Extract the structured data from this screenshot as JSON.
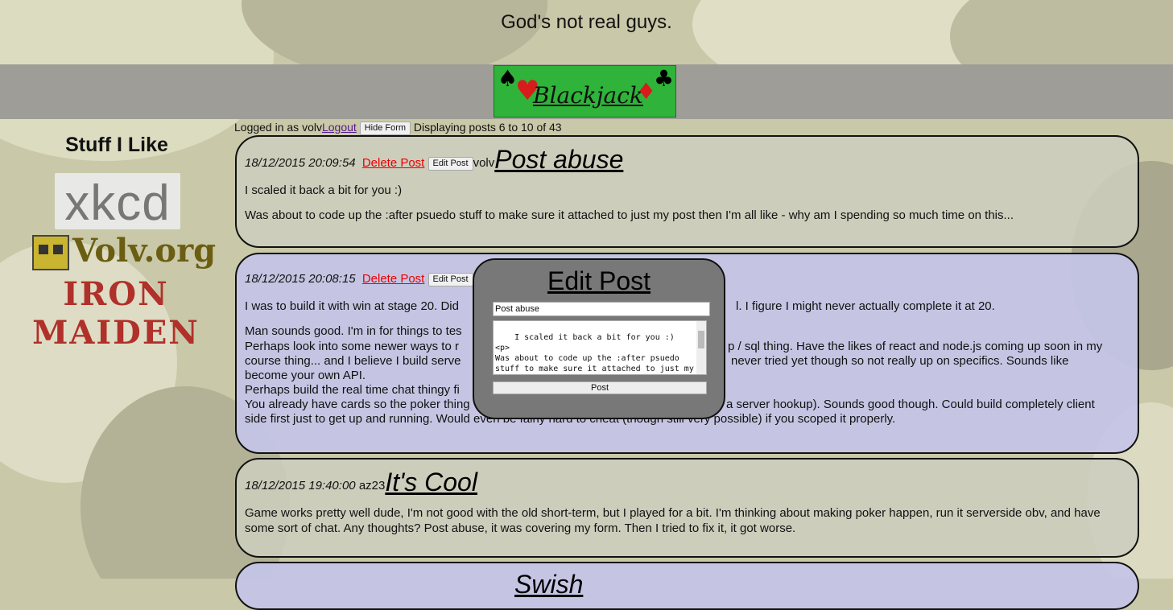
{
  "header": {
    "tagline": "God's not real guys."
  },
  "logo": {
    "title": "Blackjack",
    "suits": [
      "♠",
      "♥",
      "♦",
      "♣"
    ]
  },
  "sidebar": {
    "heading": "Stuff I Like",
    "links": [
      "xkcd",
      "Volv.org",
      "IRON MAIDEN"
    ]
  },
  "status_bar": {
    "logged_in_text": "Logged in as volv",
    "logout_label": "Logout",
    "hide_form_label": "Hide Form",
    "displaying_text": "Displaying posts 6 to 10 of 43"
  },
  "posts": [
    {
      "date": "18/12/2015 20:09:54",
      "delete_label": "Delete Post",
      "edit_label": "Edit Post",
      "author": "volv",
      "title": "Post abuse",
      "paragraphs": [
        "I scaled it back a bit for you :)",
        "Was about to code up the :after psuedo stuff to make sure it attached to just my post then I'm all like - why am I spending so much time on this..."
      ]
    },
    {
      "date": "18/12/2015 20:08:15",
      "delete_label": "Delete Post",
      "edit_label": "Edit Post",
      "lines": [
        "I was to build it with win at stage 20. Did",
        "l. I figure I might never actually complete it at 20.",
        "Man sounds good. I'm in for things to tes",
        "Perhaps look into some newer ways to r",
        "p / sql thing. Have the likes of react and node.js coming up soon in my",
        "course thing... and I believe I build serve",
        "never tried yet though so not really up on specifics. Sounds like",
        "become your own API.",
        "Perhaps build the real time chat thingy fi",
        "You already have cards so the poker thing",
        "a server hookup). Sounds good though. Could build completely client",
        "side first just to get up and running. Would even be fairly hard to cheat (though still very possible) if you scoped it properly."
      ]
    },
    {
      "date": "18/12/2015 19:40:00",
      "author": "az23",
      "title": "It's Cool",
      "paragraphs": [
        "Game works pretty well dude, I'm not good with the old short-term, but I played for a bit. I'm thinking about making poker happen, run it serverside obv, and have some sort of chat. Any thoughts? Post abuse, it was covering my form. Then I tried to fix it, it got worse."
      ]
    },
    {
      "title": "Swish"
    }
  ],
  "edit_modal": {
    "heading": "Edit Post",
    "title_value": "Post abuse",
    "body_value": "I scaled it back a bit for you :)\n<p>\nWas about to code up the :after psuedo stuff to make sure it attached to just my post then I'm all like - why am I",
    "submit_label": "Post"
  },
  "colors": {
    "camo_base": "#c9c8a8",
    "banner": "#9e9d97",
    "logo_green": "#2fb33a",
    "delete_red": "#e00000",
    "post_gray": "#cdcdbe",
    "post_lavender": "#c4c4e8",
    "modal_gray": "#787878"
  }
}
